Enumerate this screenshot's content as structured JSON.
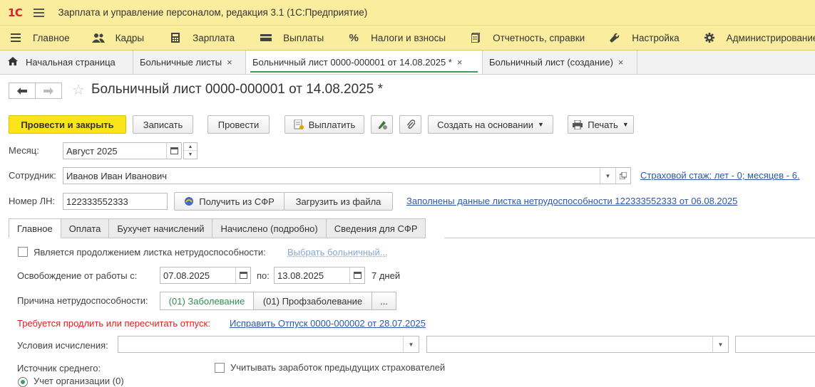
{
  "titlebar": {
    "logo": "1С",
    "title": "Зарплата и управление персоналом, редакция 3.1  (1С:Предприятие)"
  },
  "menu": [
    {
      "label": "Главное",
      "icon": "menu-lines-icon"
    },
    {
      "label": "Кадры",
      "icon": "people-icon"
    },
    {
      "label": "Зарплата",
      "icon": "calculator-icon"
    },
    {
      "label": "Выплаты",
      "icon": "wallet-icon"
    },
    {
      "label": "Налоги и взносы",
      "icon": "percent-icon"
    },
    {
      "label": "Отчетность, справки",
      "icon": "report-icon"
    },
    {
      "label": "Настройка",
      "icon": "wrench-icon"
    },
    {
      "label": "Администрирование",
      "icon": "gear-icon"
    }
  ],
  "tabs": [
    {
      "label": "Начальная страница"
    },
    {
      "label": "Больничные листы",
      "close": "×"
    },
    {
      "label": "Больничный лист 0000-000001 от 14.08.2025 *",
      "close": "×"
    },
    {
      "label": "Больничный лист (создание)",
      "close": "×"
    }
  ],
  "document": {
    "title": "Больничный лист 0000-000001 от 14.08.2025 *"
  },
  "toolbar": {
    "post_close": "Провести и закрыть",
    "save": "Записать",
    "post": "Провести",
    "pay": "Выплатить",
    "create_based": "Создать на основании",
    "print": "Печать"
  },
  "form": {
    "month_label": "Месяц:",
    "month_value": "Август 2025",
    "employee_label": "Сотрудник:",
    "employee_value": "Иванов Иван Иванович",
    "insurance_link": "Страховой стаж: лет - 0; месяцев - 6.",
    "ln_label": "Номер ЛН:",
    "ln_value": "122333552333",
    "get_sfr": "Получить из СФР",
    "load_file": "Загрузить из файла",
    "filled_link": "Заполнены данные листка нетрудоспособности 122333552333 от 06.08.2025"
  },
  "inner_tabs": [
    "Главное",
    "Оплата",
    "Бухучет начислений",
    "Начислено (подробно)",
    "Сведения для СФР"
  ],
  "main_tab": {
    "continuation_label": "Является продолжением листка нетрудоспособности:",
    "continuation_link": "Выбрать больничный...",
    "release_label": "Освобождение от работы с:",
    "release_from": "07.08.2025",
    "release_to_label": "по:",
    "release_to": "13.08.2025",
    "days": "7 дней",
    "reason_label": "Причина нетрудоспособности:",
    "reason_options": [
      "(01) Заболевание",
      "(01) Профзаболевание",
      "..."
    ],
    "warning_text": "Требуется продлить или пересчитать отпуск:",
    "warning_link": "Исправить Отпуск 0000-000002 от 28.07.2025",
    "conditions_label": "Условия исчисления:",
    "source_label": "Источник среднего:",
    "prev_insurers_label": "Учитывать заработок предыдущих страхователей",
    "org_accounting": "Учет организации (0)"
  },
  "colors": {
    "header_bg": "#fbed9e",
    "primary_button": "#fbe419",
    "link": "#2b59a8",
    "warning": "#e0201b",
    "active_green": "#3a9e5f"
  }
}
